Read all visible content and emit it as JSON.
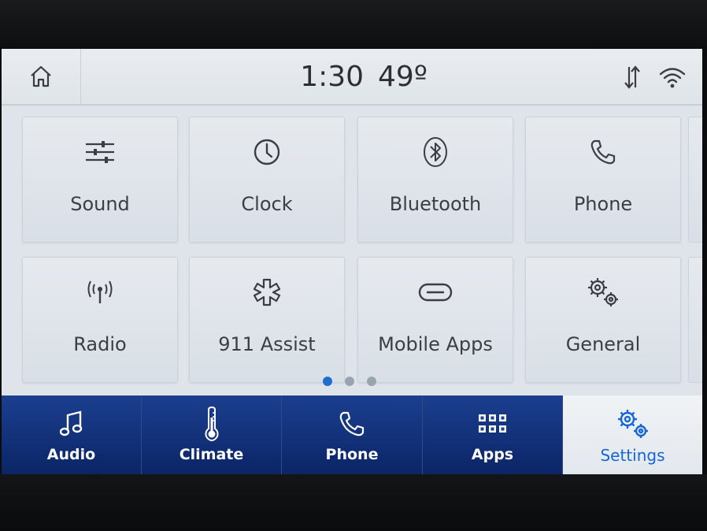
{
  "status_bar": {
    "time": "1:30",
    "temperature": "49º"
  },
  "settings_tiles": [
    {
      "label": "Sound",
      "icon": "equalizer-icon"
    },
    {
      "label": "Clock",
      "icon": "clock-icon"
    },
    {
      "label": "Bluetooth",
      "icon": "bluetooth-icon"
    },
    {
      "label": "Phone",
      "icon": "phone-icon"
    },
    {
      "label": "Radio",
      "icon": "radio-antenna-icon"
    },
    {
      "label": "911 Assist",
      "icon": "emergency-asterisk-icon"
    },
    {
      "label": "Mobile Apps",
      "icon": "link-icon"
    },
    {
      "label": "General",
      "icon": "gears-icon"
    }
  ],
  "pagination": {
    "pages": 3,
    "active": 1
  },
  "nav_bar": {
    "items": [
      {
        "label": "Audio",
        "icon": "music-note-icon",
        "selected": false
      },
      {
        "label": "Climate",
        "icon": "thermometer-icon",
        "selected": false
      },
      {
        "label": "Phone",
        "icon": "phone-icon",
        "selected": false
      },
      {
        "label": "Apps",
        "icon": "apps-grid-icon",
        "selected": false
      },
      {
        "label": "Settings",
        "icon": "gears-icon",
        "selected": true
      }
    ]
  },
  "colors": {
    "accent": "#1f6fd1",
    "nav_background": "#1b3f8f",
    "selected_label": "#1666d6"
  }
}
